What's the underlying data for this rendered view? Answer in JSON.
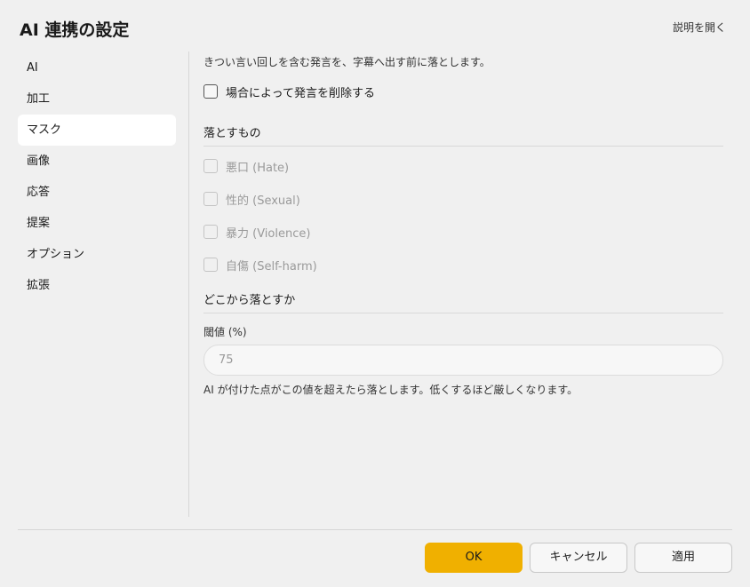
{
  "dialog": {
    "title": "AI 連携の設定",
    "help_link": "説明を開く"
  },
  "sidebar": {
    "items": [
      {
        "label": "AI",
        "active": false
      },
      {
        "label": "加工",
        "active": false
      },
      {
        "label": "マスク",
        "active": true
      },
      {
        "label": "画像",
        "active": false
      },
      {
        "label": "応答",
        "active": false
      },
      {
        "label": "提案",
        "active": false
      },
      {
        "label": "オプション",
        "active": false
      },
      {
        "label": "拡張",
        "active": false
      }
    ]
  },
  "content": {
    "description": "きつい言い回しを含む発言を、字幕へ出す前に落とします。",
    "main_checkbox": {
      "label": "場合によって発言を削除する",
      "checked": false
    },
    "section1_title": "落とすもの",
    "categories": [
      {
        "label": "悪口 (Hate)",
        "checked": false,
        "disabled": true
      },
      {
        "label": "性的 (Sexual)",
        "checked": false,
        "disabled": true
      },
      {
        "label": "暴力 (Violence)",
        "checked": false,
        "disabled": true
      },
      {
        "label": "自傷 (Self-harm)",
        "checked": false,
        "disabled": true
      }
    ],
    "section2_title": "どこから落とすか",
    "threshold": {
      "label": "閾値 (%)",
      "value": "75",
      "hint": "AI が付けた点がこの値を超えたら落とします。低くするほど厳しくなります。"
    }
  },
  "footer": {
    "ok_label": "OK",
    "cancel_label": "キャンセル",
    "apply_label": "適用"
  },
  "colors": {
    "accent": "#f0b000",
    "background": "#f0f0f0",
    "active_item": "#ffffff"
  }
}
